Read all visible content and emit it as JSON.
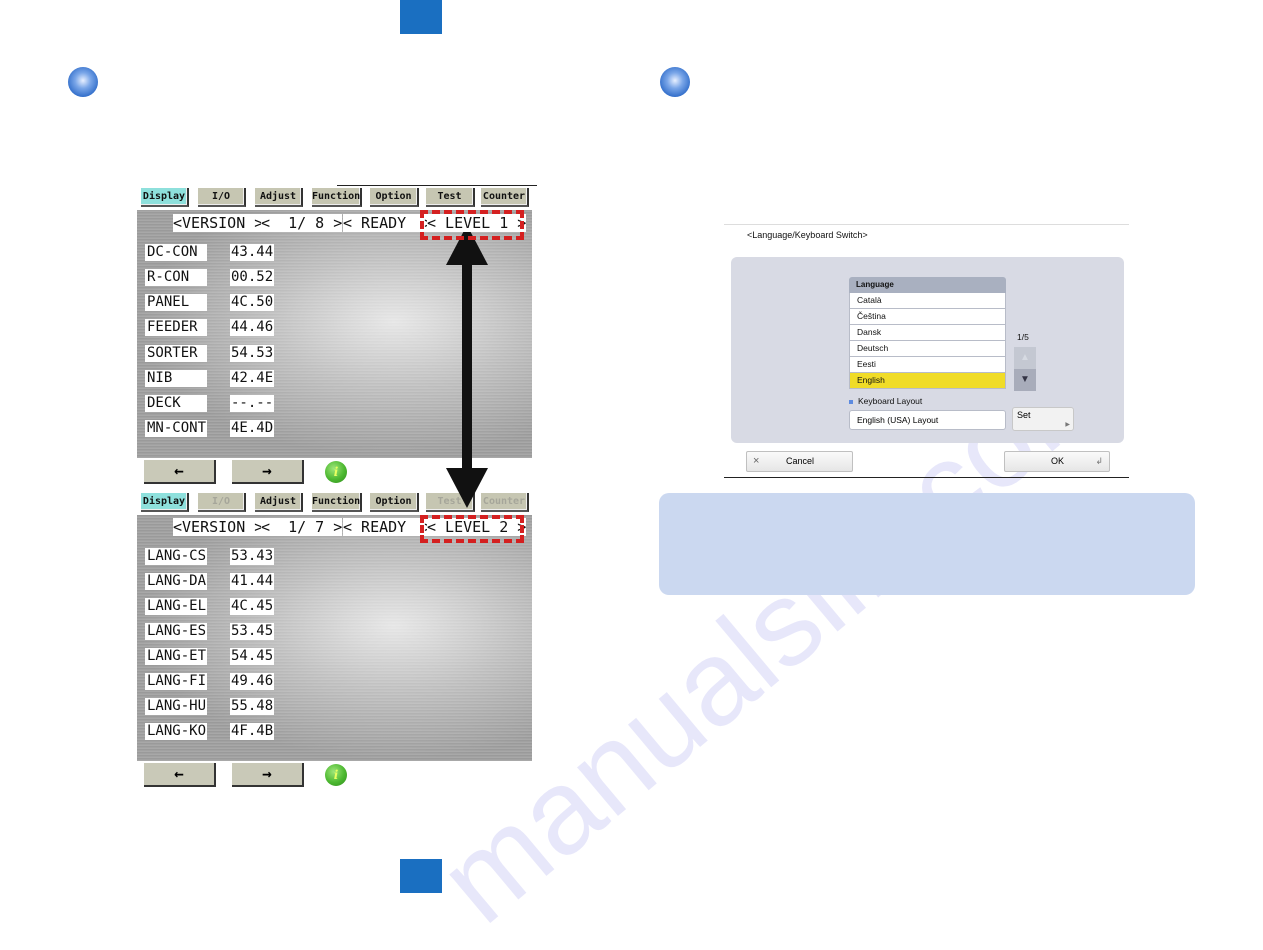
{
  "page": {
    "header_tab_color": "#1a6fc1",
    "note_box_color": "#cbd8f0",
    "watermark": "manualslib.com"
  },
  "service_mode": {
    "panels": [
      {
        "tabs": [
          {
            "label": "Display",
            "state": "active"
          },
          {
            "label": "I/O",
            "state": "normal"
          },
          {
            "label": "Adjust",
            "state": "normal"
          },
          {
            "label": "Function",
            "state": "normal"
          },
          {
            "label": "Option",
            "state": "normal"
          },
          {
            "label": "Test",
            "state": "normal"
          },
          {
            "label": "Counter",
            "state": "normal"
          }
        ],
        "header": {
          "item": "<VERSION >",
          "page": "<  1/ 8 >",
          "status": "< READY  >",
          "level": "< LEVEL 1 >"
        },
        "rows": [
          {
            "label": "DC-CON",
            "value": "43.44"
          },
          {
            "label": "R-CON",
            "value": "00.52"
          },
          {
            "label": "PANEL",
            "value": "4C.50"
          },
          {
            "label": "FEEDER",
            "value": "44.46"
          },
          {
            "label": "SORTER",
            "value": "54.53"
          },
          {
            "label": "NIB",
            "value": "42.4E"
          },
          {
            "label": "DECK",
            "value": "--.--"
          },
          {
            "label": "MN-CONT",
            "value": "4E.4D"
          }
        ],
        "nav": {
          "prev": "←",
          "next": "→",
          "info": "i"
        }
      },
      {
        "tabs": [
          {
            "label": "Display",
            "state": "active"
          },
          {
            "label": "I/O",
            "state": "disabled"
          },
          {
            "label": "Adjust",
            "state": "normal"
          },
          {
            "label": "Function",
            "state": "normal"
          },
          {
            "label": "Option",
            "state": "normal"
          },
          {
            "label": "Test",
            "state": "disabled"
          },
          {
            "label": "Counter",
            "state": "disabled"
          }
        ],
        "header": {
          "item": "<VERSION >",
          "page": "<  1/ 7 >",
          "status": "< READY  >",
          "level": "< LEVEL 2 >"
        },
        "rows": [
          {
            "label": "LANG-CS",
            "value": "53.43"
          },
          {
            "label": "LANG-DA",
            "value": "41.44"
          },
          {
            "label": "LANG-EL",
            "value": "4C.45"
          },
          {
            "label": "LANG-ES",
            "value": "53.45"
          },
          {
            "label": "LANG-ET",
            "value": "54.45"
          },
          {
            "label": "LANG-FI",
            "value": "49.46"
          },
          {
            "label": "LANG-HU",
            "value": "55.48"
          },
          {
            "label": "LANG-KO",
            "value": "4F.4B"
          }
        ],
        "nav": {
          "prev": "←",
          "next": "→",
          "info": "i"
        }
      }
    ]
  },
  "language_dialog": {
    "title": "<Language/Keyboard Switch>",
    "list_header": "Language",
    "languages": [
      {
        "label": "Català",
        "selected": false
      },
      {
        "label": "Čeština",
        "selected": false
      },
      {
        "label": "Dansk",
        "selected": false
      },
      {
        "label": "Deutsch",
        "selected": false
      },
      {
        "label": "Eesti",
        "selected": false
      },
      {
        "label": "English",
        "selected": true
      }
    ],
    "page_indicator": "1/5",
    "scroll_up": "▲",
    "scroll_down": "▼",
    "keyboard_layout_label": "Keyboard Layout",
    "keyboard_layout_value": "English (USA) Layout",
    "set_button": "Set",
    "cancel_button": "Cancel",
    "cancel_icon": "×",
    "ok_button": "OK",
    "ok_icon": "↲",
    "selected_color": "#f0dc28"
  }
}
